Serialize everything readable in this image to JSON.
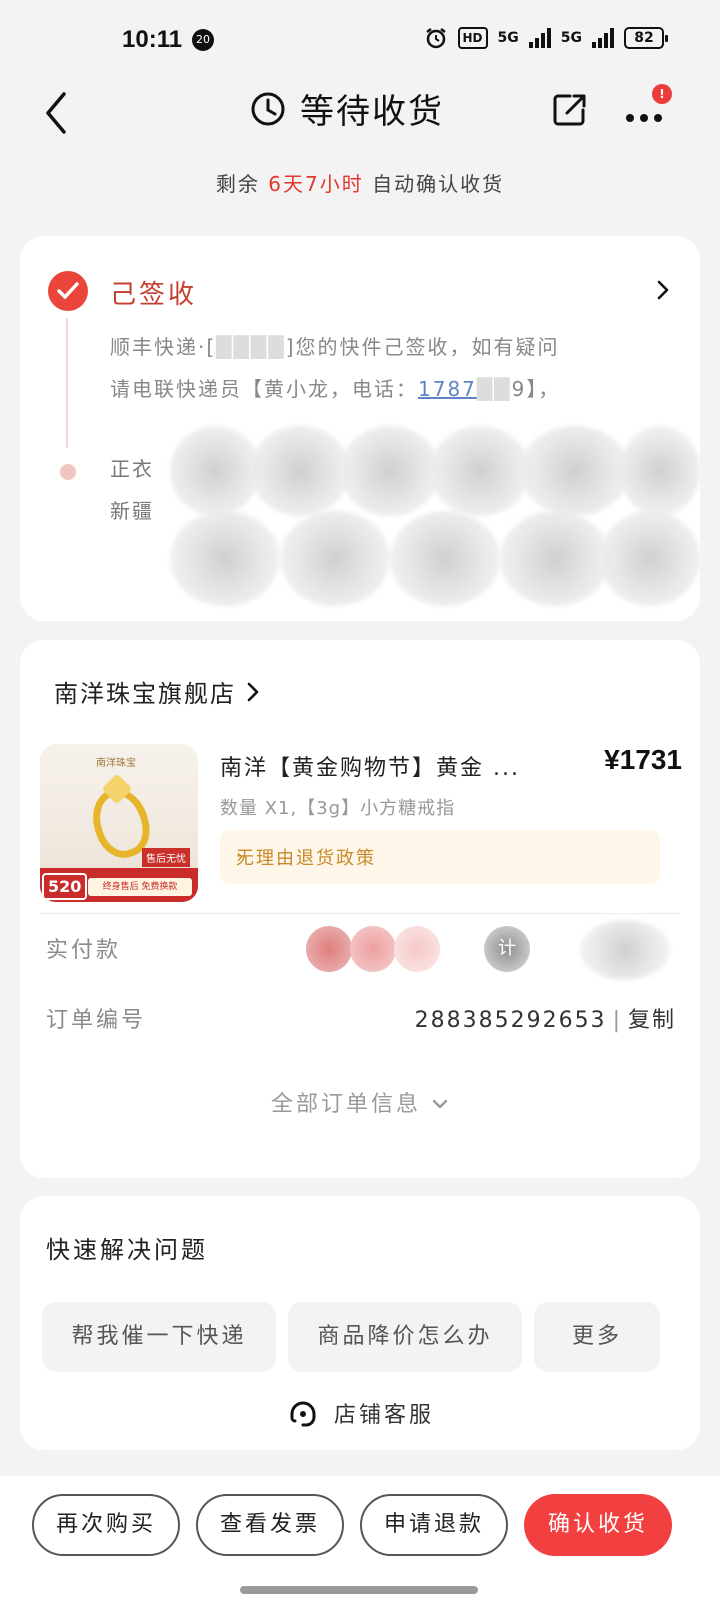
{
  "status_bar": {
    "time": "10:11",
    "notif_count": "20",
    "hd": "HD",
    "sig1": "5G",
    "sig2": "5G",
    "battery": "82"
  },
  "header": {
    "title": "等待收货",
    "more_badge": "!"
  },
  "countdown": {
    "prefix": "剩余",
    "days": "6天",
    "hours": "7小时",
    "suffix": "自动确认收货"
  },
  "logistics": {
    "status": "己签收",
    "line1a": "顺丰快递·[",
    "line1b": "]您的快件己签收，如有疑问",
    "line2a": "请电联快递员【黄小龙，电话：",
    "phone": "1787",
    "line2b": "9】，",
    "line3": "正衣",
    "line4": "新疆"
  },
  "order": {
    "shop_name": "南洋珠宝旗舰店",
    "product": {
      "brand_mark": "南洋珠宝",
      "tag": "售后无忧",
      "promo_badge": "520",
      "strip_text": "终身售后 免费换款",
      "title": "南洋【黄金购物节】黄金 ...",
      "price": "¥1731",
      "spec": "数量 X1,【3g】小方糖戒指",
      "policy": "无理由退货政策"
    },
    "paid_label": "实付款",
    "calc_glyph": "计",
    "order_no_label": "订单编号",
    "order_no": "288385292653",
    "copy_label": "复制",
    "all_info": "全部订单信息"
  },
  "quick": {
    "title": "快速解决问题",
    "chips": [
      "帮我催一下快递",
      "商品降价怎么办",
      "更多"
    ],
    "service": "店铺客服"
  },
  "bottom": {
    "buttons": [
      "再次购买",
      "查看发票",
      "申请退款",
      "确认收货"
    ]
  },
  "colors": {
    "accent": "#f23f3f",
    "signed": "#c3402f",
    "policy": "#c98a28"
  }
}
